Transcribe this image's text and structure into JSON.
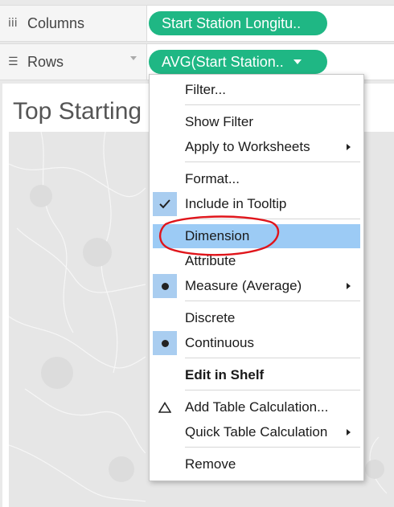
{
  "shelves": {
    "columns": {
      "label": "Columns",
      "pill": "Start Station Longitu.."
    },
    "rows": {
      "label": "Rows",
      "pill": "AVG(Start Station.."
    }
  },
  "viz": {
    "title": "Top Starting"
  },
  "menu": {
    "items": [
      {
        "label": "Filter..."
      },
      {
        "label": "Show Filter"
      },
      {
        "label": "Apply to Worksheets",
        "submenu": true
      },
      {
        "label": "Format..."
      },
      {
        "label": "Include in Tooltip",
        "checked": true
      },
      {
        "label": "Dimension",
        "highlighted": true,
        "annotated": true
      },
      {
        "label": "Attribute"
      },
      {
        "label": "Measure (Average)",
        "selected": true,
        "submenu": true
      },
      {
        "label": "Discrete"
      },
      {
        "label": "Continuous",
        "selected": true
      },
      {
        "label": "Edit in Shelf",
        "bold": true
      },
      {
        "label": "Add Table Calculation...",
        "icon": "triangle-icon"
      },
      {
        "label": "Quick Table Calculation",
        "submenu": true
      },
      {
        "label": "Remove"
      }
    ]
  },
  "colors": {
    "pill": "#1fb784",
    "highlight": "#9ccbf5",
    "annotation": "#e0151b"
  }
}
